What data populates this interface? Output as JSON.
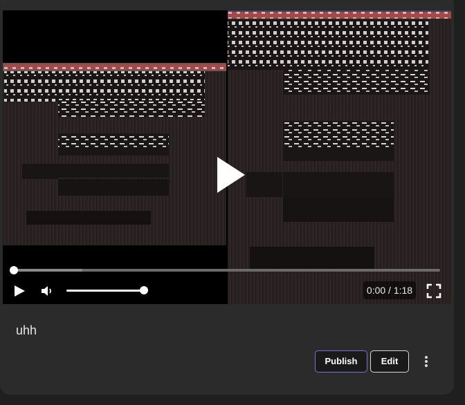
{
  "video": {
    "current_time": "0:00",
    "duration": "1:18",
    "progress": 0.0,
    "buffered": 0.16,
    "volume": 1.0
  },
  "post": {
    "title": "uhh"
  },
  "actions": {
    "publish_label": "Publish",
    "edit_label": "Edit"
  },
  "icons": {
    "play_overlay": "play-icon",
    "play": "play-icon",
    "mute": "volume-icon",
    "fullscreen": "fullscreen-icon",
    "more": "more-vertical-icon"
  },
  "colors": {
    "card_bg": "#2b2b2b",
    "publish_border": "#7a72d9",
    "edit_border": "#d8d8d8"
  }
}
